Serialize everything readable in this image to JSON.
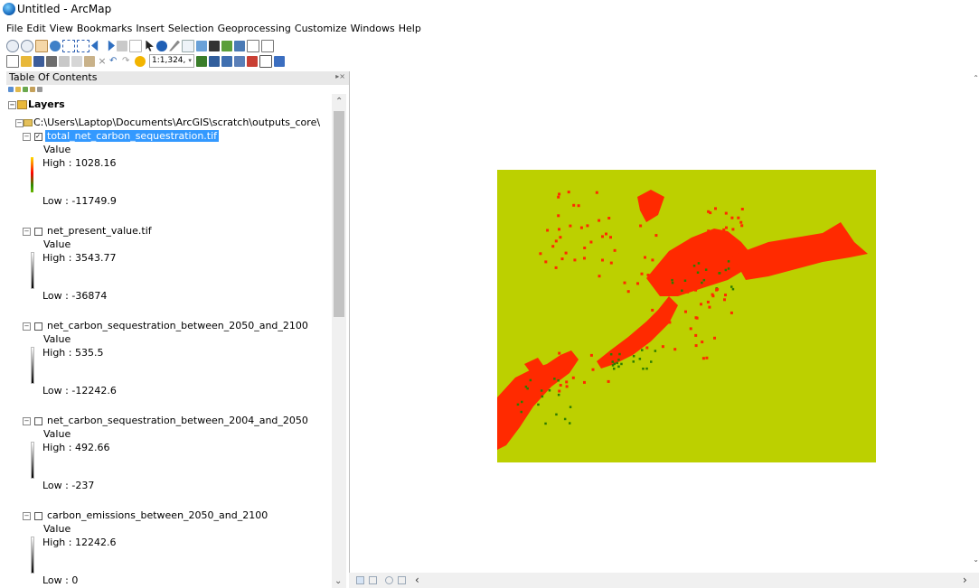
{
  "window": {
    "title": "Untitled - ArcMap"
  },
  "menu": [
    "File",
    "Edit",
    "View",
    "Bookmarks",
    "Insert",
    "Selection",
    "Geoprocessing",
    "Customize",
    "Windows",
    "Help"
  ],
  "toolbar": {
    "scale": "1:1,324,"
  },
  "toc": {
    "title": "Table Of Contents",
    "root_label": "Layers",
    "group_path": "C:\\Users\\Laptop\\Documents\\ArcGIS\\scratch\\outputs_core\\",
    "layers": [
      {
        "name": "total_net_carbon_sequestration.tif",
        "value_label": "Value",
        "high": "High : 1028.16",
        "low": "Low : -11749.9",
        "selected": true,
        "ramp": "color"
      },
      {
        "name": "net_present_value.tif",
        "value_label": "Value",
        "high": "High : 3543.77",
        "low": "Low : -36874",
        "selected": false,
        "ramp": "bw"
      },
      {
        "name": "net_carbon_sequestration_between_2050_and_2100",
        "value_label": "Value",
        "high": "High : 535.5",
        "low": "Low : -12242.6",
        "selected": false,
        "ramp": "bw"
      },
      {
        "name": "net_carbon_sequestration_between_2004_and_2050",
        "value_label": "Value",
        "high": "High : 492.66",
        "low": "Low : -237",
        "selected": false,
        "ramp": "bw"
      },
      {
        "name": "carbon_emissions_between_2050_and_2100",
        "value_label": "Value",
        "high": "High : 12242.6",
        "low": "Low : 0",
        "selected": false,
        "ramp": "bw"
      }
    ]
  },
  "map": {
    "background_color": "#bcd000",
    "feature_color": "#ff2a00",
    "low_value_color": "#2e7d00"
  }
}
